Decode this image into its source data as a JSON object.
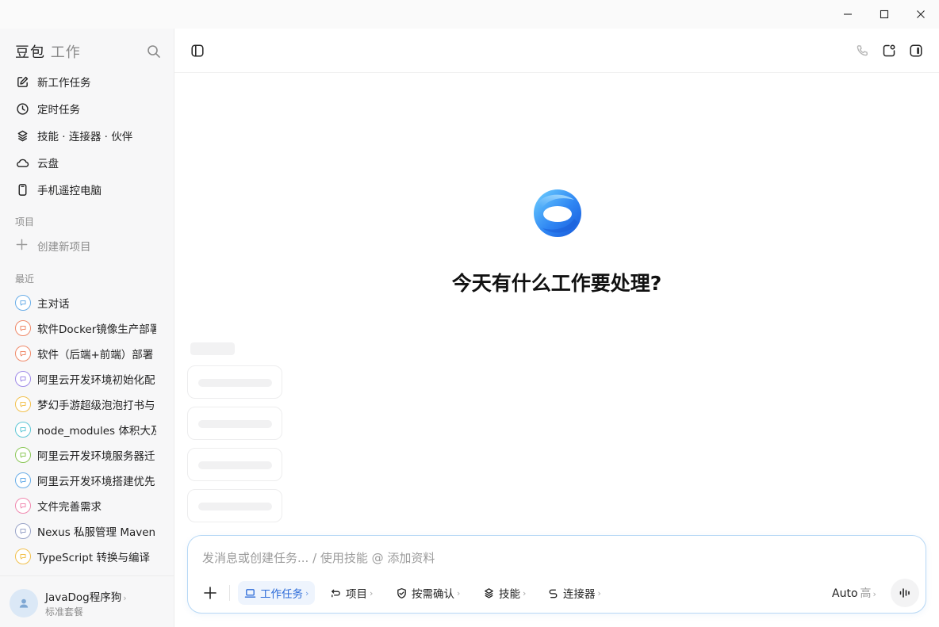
{
  "window": {
    "controls": [
      "minimize",
      "maximize",
      "close"
    ]
  },
  "sidebar": {
    "brand_main": "豆包",
    "brand_sub": "工作",
    "nav": [
      {
        "label": "新工作任务",
        "icon": "edit-icon"
      },
      {
        "label": "定时任务",
        "icon": "clock-icon"
      },
      {
        "label": "技能 · 连接器 · 伙伴",
        "icon": "layers-icon"
      },
      {
        "label": "云盘",
        "icon": "cloud-icon"
      },
      {
        "label": "手机遥控电脑",
        "icon": "phone-icon"
      }
    ],
    "projects_label": "项目",
    "new_project_label": "创建新项目",
    "recent_label": "最近",
    "recent": [
      {
        "label": "主对话",
        "color": "#6aaee8"
      },
      {
        "label": "软件Docker镜像生产部署",
        "color": "#f08a6a"
      },
      {
        "label": "软件（后端+前端）部署",
        "color": "#f08a6a"
      },
      {
        "label": "阿里云开发环境初始化配",
        "color": "#a08be8"
      },
      {
        "label": "梦幻手游超级泡泡打书与",
        "color": "#f2c14e"
      },
      {
        "label": "node_modules 体积大及",
        "color": "#5fc7d6"
      },
      {
        "label": "阿里云开发环境服务器迁",
        "color": "#8dc85a"
      },
      {
        "label": "阿里云开发环境搭建优先",
        "color": "#6aaee8"
      },
      {
        "label": "文件完善需求",
        "color": "#f08ab0"
      },
      {
        "label": "Nexus 私服管理 Maven",
        "color": "#9aa4c8"
      },
      {
        "label": "TypeScript 转换与编译",
        "color": "#f2c14e"
      }
    ],
    "user": {
      "name": "JavaDog程序狗",
      "plan": "标准套餐"
    }
  },
  "main": {
    "headline": "今天有什么工作要处理?"
  },
  "composer": {
    "placeholder": "发消息或创建任务... / 使用技能 @ 添加资料",
    "chips": [
      {
        "label": "工作任务",
        "icon": "laptop-icon",
        "active": true
      },
      {
        "label": "项目",
        "icon": "project-icon",
        "active": false
      },
      {
        "label": "按需确认",
        "icon": "shield-check-icon",
        "active": false
      },
      {
        "label": "技能",
        "icon": "layers-icon",
        "active": false
      },
      {
        "label": "连接器",
        "icon": "link-icon",
        "active": false
      }
    ],
    "chevron": "›",
    "model": "Auto",
    "level": "高"
  },
  "colors": {
    "accent": "#2b6ad8",
    "composer_border": "#b7d8f5"
  }
}
